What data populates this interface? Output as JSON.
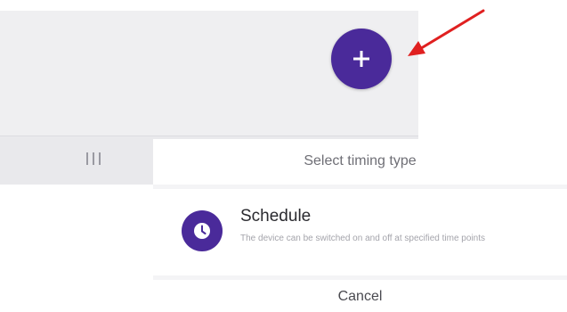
{
  "background_screen": {
    "fab_icon": "plus-icon",
    "bottom_nav_icon": "menu-lines-icon"
  },
  "annotation": {
    "arrow_color": "#e02020"
  },
  "sheet": {
    "title": "Select timing type",
    "option": {
      "icon": "clock-icon",
      "title": "Schedule",
      "description": "The device can be switched on and off at specified time points"
    },
    "cancel_label": "Cancel"
  },
  "colors": {
    "accent": "#4a2a9a",
    "background": "#efeff1"
  }
}
